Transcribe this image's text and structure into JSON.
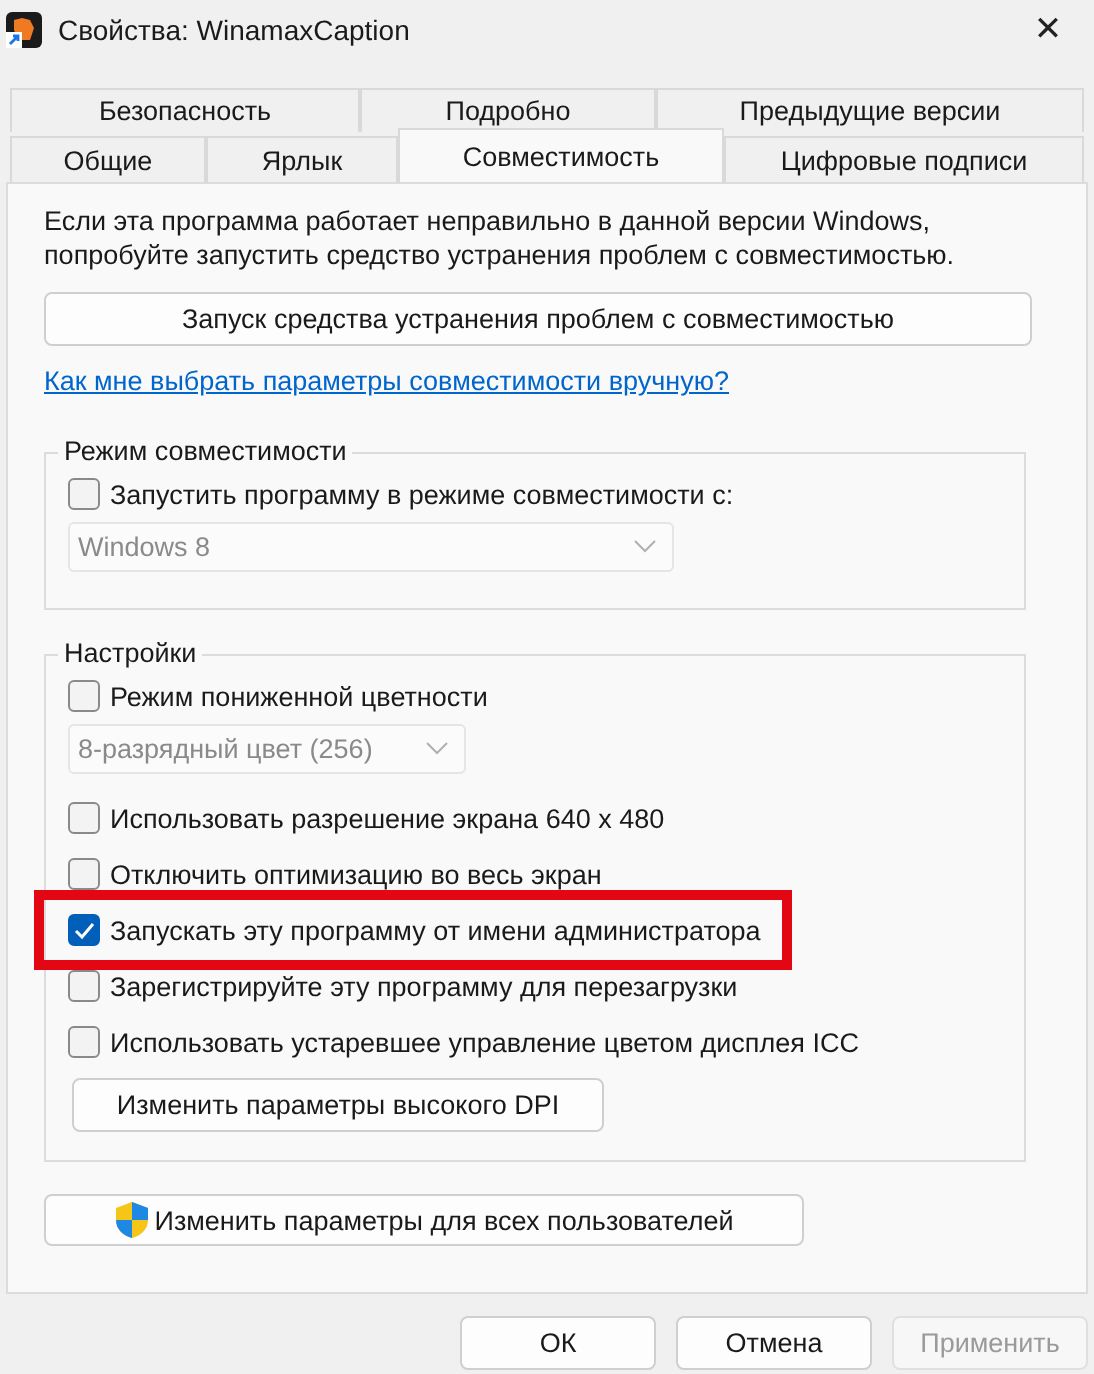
{
  "window": {
    "title": "Свойства: WinamaxCaption",
    "close": "✕"
  },
  "tab_rows": [
    {
      "tabs": [
        {
          "label": "Безопасность",
          "selected": false
        },
        {
          "label": "Подробно",
          "selected": false
        },
        {
          "label": "Предыдущие версии",
          "selected": false
        }
      ]
    },
    {
      "tabs": [
        {
          "label": "Общие",
          "selected": false
        },
        {
          "label": "Ярлык",
          "selected": false
        },
        {
          "label": "Совместимость",
          "selected": true
        },
        {
          "label": "Цифровые подписи",
          "selected": false
        }
      ]
    }
  ],
  "intro": "Если эта программа работает неправильно в данной версии Windows, попробуйте запустить средство устранения проблем с совместимостью.",
  "troubleshooter_button": "Запуск средства устранения проблем с совместимостью",
  "help_link": "Как мне выбрать параметры совместимости вручную?",
  "groups": [
    {
      "title": "Режим совместимости",
      "items": [
        {
          "kind": "checkbox",
          "label": "Запустить программу в режиме совместимости с:",
          "checked": false,
          "highlighted": false
        },
        {
          "kind": "dropdown",
          "value": "Windows 8",
          "disabled": true
        }
      ]
    },
    {
      "title": "Настройки",
      "items": [
        {
          "kind": "checkbox",
          "label": "Режим пониженной цветности",
          "checked": false,
          "highlighted": false
        },
        {
          "kind": "dropdown",
          "value": "8-разрядный цвет (256)",
          "disabled": true
        },
        {
          "kind": "checkbox",
          "label": "Использовать разрешение экрана 640 x 480",
          "checked": false,
          "highlighted": false
        },
        {
          "kind": "checkbox",
          "label": "Отключить оптимизацию во весь экран",
          "checked": false,
          "highlighted": false
        },
        {
          "kind": "checkbox",
          "label": "Запускать эту программу от имени администратора",
          "checked": true,
          "highlighted": true
        },
        {
          "kind": "checkbox",
          "label": "Зарегистрируйте эту программу для перезагрузки",
          "checked": false,
          "highlighted": false
        },
        {
          "kind": "checkbox",
          "label": "Использовать устаревшее управление цветом дисплея ICC",
          "checked": false,
          "highlighted": false
        },
        {
          "kind": "button",
          "label": "Изменить параметры высокого DPI"
        }
      ]
    }
  ],
  "all_users_button": "Изменить параметры для всех пользователей",
  "buttons": [
    {
      "label": "ОК",
      "disabled": false
    },
    {
      "label": "Отмена",
      "disabled": false
    },
    {
      "label": "Применить",
      "disabled": true
    }
  ]
}
